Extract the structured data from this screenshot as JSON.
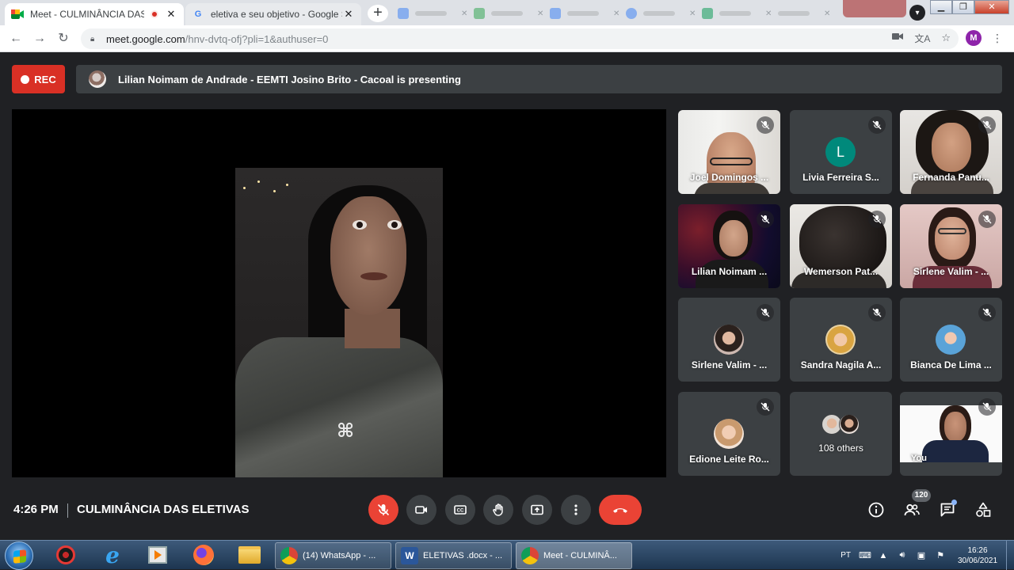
{
  "browser": {
    "tabs": [
      {
        "title": "Meet - CULMINÂNCIA DAS E"
      },
      {
        "title": "eletiva e seu objetivo - Google S"
      }
    ],
    "url_host": "meet.google.com",
    "url_path": "/hnv-dvtq-ofj?pli=1&authuser=0",
    "profile_initial": "M"
  },
  "meet": {
    "rec_label": "REC",
    "presenting_text": "Lilian Noimam de Andrade - EEMTI Josino Brito - Cacoal is presenting",
    "participants": [
      {
        "name": "Joel Domingos ..."
      },
      {
        "name": "Livia Ferreira S...",
        "initial": "L"
      },
      {
        "name": "Fernanda Panu..."
      },
      {
        "name": "Lilian Noimam ..."
      },
      {
        "name": "Wemerson Pat..."
      },
      {
        "name": "Sirlene Valim - ..."
      },
      {
        "name": "Sirlene Valim - ..."
      },
      {
        "name": "Sandra Nagila A..."
      },
      {
        "name": "Bianca De Lima ..."
      },
      {
        "name": "Edione Leite Ro..."
      },
      {
        "name": "108 others"
      },
      {
        "name": "You"
      }
    ],
    "time": "4:26 PM",
    "meeting_title": "CULMINÂNCIA DAS ELETIVAS",
    "participant_count": "120"
  },
  "taskbar": {
    "tasks": [
      {
        "label": "(14) WhatsApp - ..."
      },
      {
        "label": "ELETIVAS .docx - ..."
      },
      {
        "label": "Meet - CULMINÂ..."
      }
    ],
    "language": "PT",
    "clock_time": "16:26",
    "clock_date": "30/06/2021"
  },
  "colors": {
    "rec_red": "#d93025",
    "end_call_red": "#ea4335",
    "meet_bg": "#202124",
    "tile_bg": "#3c4043",
    "avatar_teal": "#00897b"
  }
}
